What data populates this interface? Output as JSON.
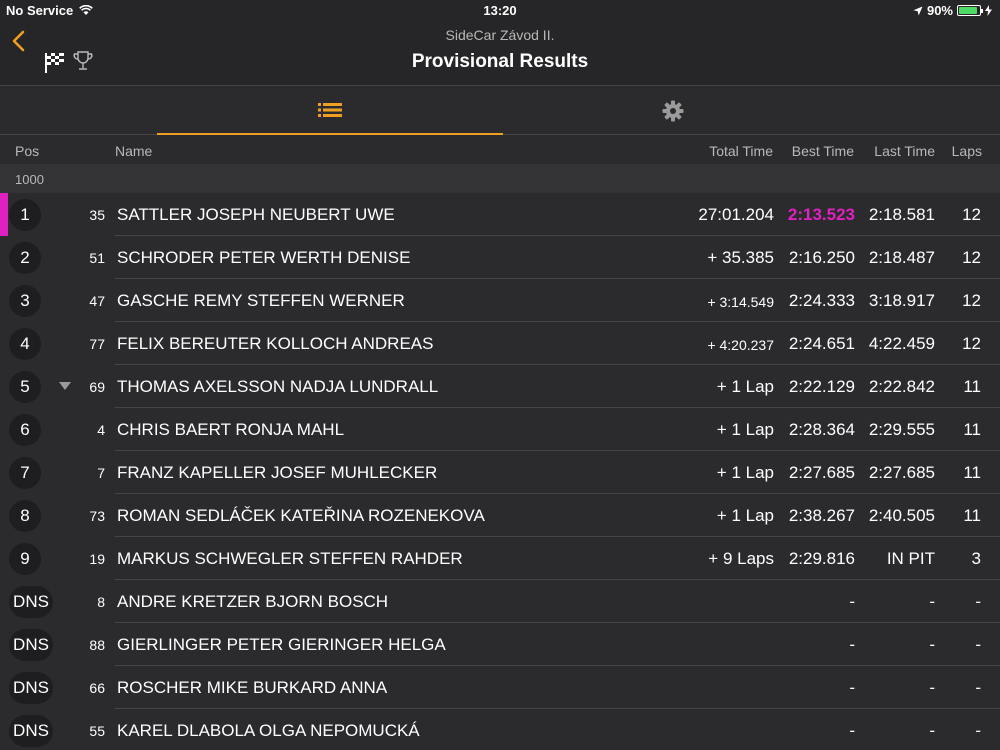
{
  "status": {
    "carrier": "No Service",
    "time": "13:20",
    "battery": "90%",
    "battery_level": 0.9
  },
  "nav": {
    "subtitle": "SideCar Závod II.",
    "title": "Provisional Results"
  },
  "columns": {
    "pos": "Pos",
    "name": "Name",
    "total": "Total Time",
    "best": "Best Time",
    "last": "Last Time",
    "laps": "Laps"
  },
  "group": {
    "label": "1000"
  },
  "colors": {
    "accent": "#f0a020",
    "fastest": "#e020c0"
  },
  "rows": [
    {
      "pos": "1",
      "num": "35",
      "name": "SATTLER JOSEPH NEUBERT UWE",
      "total": "27:01.204",
      "best": "2:13.523",
      "last": "2:18.581",
      "laps": "12"
    },
    {
      "pos": "2",
      "num": "51",
      "name": "SCHRODER PETER WERTH DENISE",
      "total": "+ 35.385",
      "best": "2:16.250",
      "last": "2:18.487",
      "laps": "12"
    },
    {
      "pos": "3",
      "num": "47",
      "name": "GASCHE REMY STEFFEN WERNER",
      "total": "+ 3:14.549",
      "best": "2:24.333",
      "last": "3:18.917",
      "laps": "12"
    },
    {
      "pos": "4",
      "num": "77",
      "name": "FELIX BEREUTER KOLLOCH ANDREAS",
      "total": "+ 4:20.237",
      "best": "2:24.651",
      "last": "4:22.459",
      "laps": "12"
    },
    {
      "pos": "5",
      "num": "69",
      "name": "THOMAS AXELSSON NADJA LUNDRALL",
      "total": "+ 1 Lap",
      "best": "2:22.129",
      "last": "2:22.842",
      "laps": "11"
    },
    {
      "pos": "6",
      "num": "4",
      "name": "CHRIS BAERT RONJA MAHL",
      "total": "+ 1 Lap",
      "best": "2:28.364",
      "last": "2:29.555",
      "laps": "11"
    },
    {
      "pos": "7",
      "num": "7",
      "name": "FRANZ KAPELLER  JOSEF MUHLECKER",
      "total": "+ 1 Lap",
      "best": "2:27.685",
      "last": "2:27.685",
      "laps": "11"
    },
    {
      "pos": "8",
      "num": "73",
      "name": "ROMAN SEDLÁČEK KATEŘINA ROZENEKOVA",
      "total": "+ 1 Lap",
      "best": "2:38.267",
      "last": "2:40.505",
      "laps": "11"
    },
    {
      "pos": "9",
      "num": "19",
      "name": "MARKUS SCHWEGLER STEFFEN  RAHDER",
      "total": "+ 9 Laps",
      "best": "2:29.816",
      "last": "IN PIT",
      "laps": "3"
    },
    {
      "pos": "DNS",
      "num": "8",
      "name": "ANDRE KRETZER BJORN BOSCH",
      "total": "",
      "best": "-",
      "last": "-",
      "laps": "-"
    },
    {
      "pos": "DNS",
      "num": "88",
      "name": "GIERLINGER PETER GIERINGER HELGA",
      "total": "",
      "best": "-",
      "last": "-",
      "laps": "-"
    },
    {
      "pos": "DNS",
      "num": "66",
      "name": "ROSCHER MIKE BURKARD ANNA",
      "total": "",
      "best": "-",
      "last": "-",
      "laps": "-"
    },
    {
      "pos": "DNS",
      "num": "55",
      "name": "KAREL DLABOLA OLGA NEPOMUCKÁ",
      "total": "",
      "best": "-",
      "last": "-",
      "laps": "-"
    }
  ]
}
